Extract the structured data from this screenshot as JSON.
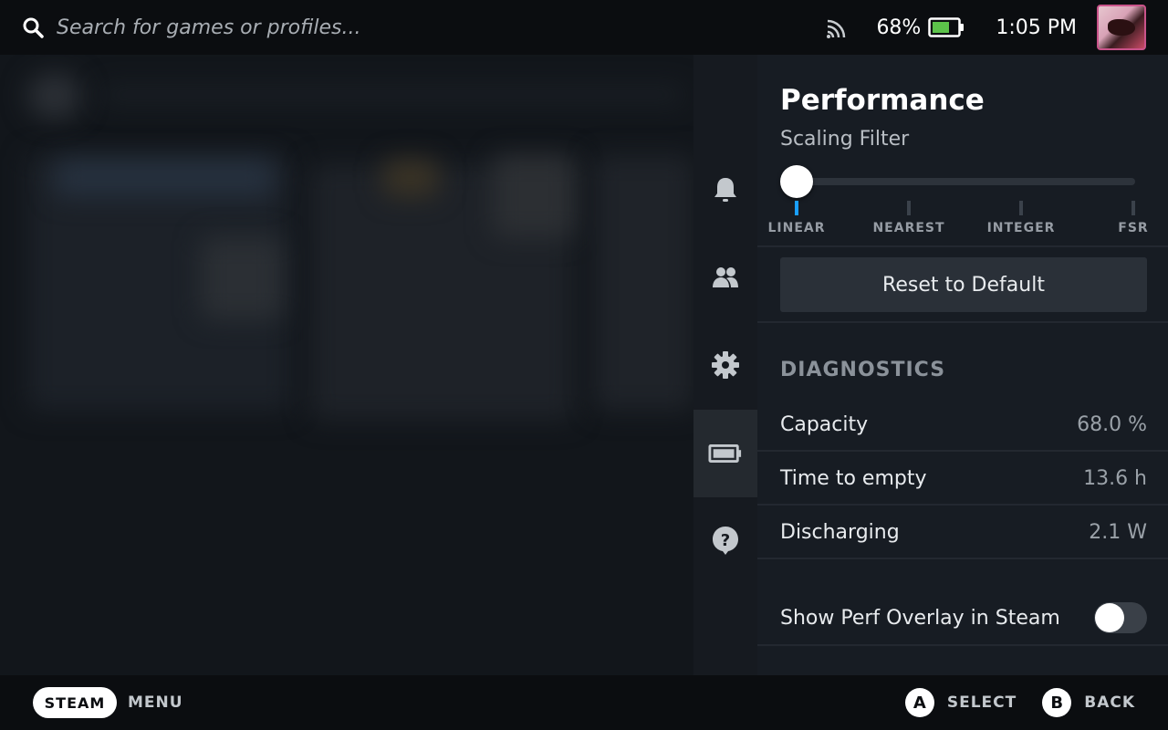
{
  "topbar": {
    "search_placeholder": "Search for games or profiles...",
    "battery_percent": "68%",
    "time": "1:05 PM"
  },
  "rail": {
    "items": [
      "bell-icon",
      "friends-icon",
      "gear-icon",
      "battery-icon",
      "help-icon"
    ],
    "active": "battery-icon"
  },
  "panel": {
    "title": "Performance",
    "scaling_filter_label": "Scaling Filter",
    "scaling_options": [
      "LINEAR",
      "NEAREST",
      "INTEGER",
      "FSR"
    ],
    "scaling_selected": "LINEAR",
    "reset_label": "Reset to Default",
    "diagnostics_heading": "DIAGNOSTICS",
    "diagnostics": [
      {
        "label": "Capacity",
        "value": "68.0 %"
      },
      {
        "label": "Time to empty",
        "value": "13.6 h"
      },
      {
        "label": "Discharging",
        "value": "2.1 W"
      }
    ],
    "overlay_label": "Show Perf Overlay in Steam",
    "overlay_enabled": false
  },
  "bottombar": {
    "steam_label": "STEAM",
    "menu_label": "MENU",
    "a_glyph": "A",
    "a_label": "SELECT",
    "b_glyph": "B",
    "b_label": "BACK"
  },
  "colors": {
    "accent": "#1a9fff",
    "battery_fill": "#5cc24a",
    "avatar_border": "#c9538a"
  }
}
